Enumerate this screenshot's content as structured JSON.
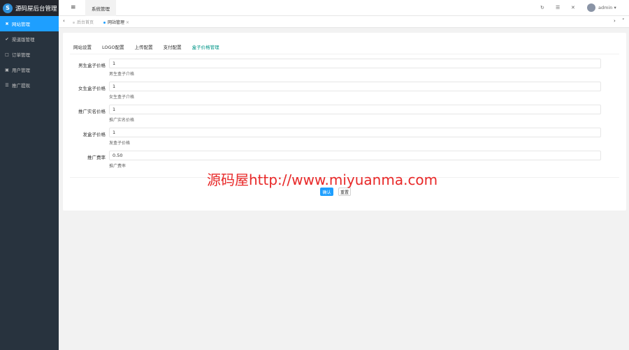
{
  "app": {
    "logo_text": "源码屋后台管理",
    "logo_mark": "S"
  },
  "sidebar": {
    "items": [
      {
        "label": "网站管理",
        "icon": "✖"
      },
      {
        "label": "渠道版管理",
        "icon": "✔"
      },
      {
        "label": "订单管理",
        "icon": "□"
      },
      {
        "label": "用户管理",
        "icon": "▣"
      },
      {
        "label": "推广提现",
        "icon": "☰"
      }
    ]
  },
  "header": {
    "menu_icon": "≡",
    "tab_label": "系统管理",
    "refresh_icon": "↻",
    "note_icon": "☰",
    "fullscreen_icon": "✕",
    "username": "admin",
    "caret": "▾"
  },
  "tabsbar": {
    "left_arrow": "‹",
    "home_label": "后台首页",
    "current_label": "网站管理",
    "close_glyph": "×",
    "right_arrow": "›",
    "more_arrow": "˅"
  },
  "settings": {
    "tabs": [
      "网站设置",
      "LOGO配置",
      "上传配置",
      "支付配置",
      "盒子价格管理"
    ],
    "fields": [
      {
        "label": "男生盒子价格",
        "value": "1",
        "help": "男生盒子介格"
      },
      {
        "label": "女生盒子价格",
        "value": "1",
        "help": "女生盒子介格"
      },
      {
        "label": "推广实名价格",
        "value": "1",
        "help": "推广实名价格"
      },
      {
        "label": "发盒子价格",
        "value": "1",
        "help": "发盒子价格"
      },
      {
        "label": "推广费率",
        "value": "0.50",
        "help": "推广费率"
      }
    ],
    "submit_label": "确认",
    "reset_label": "重置"
  },
  "watermark": "源码屋http://www.miyuanma.com",
  "colors": {
    "accent": "#1e9fff",
    "sidebar": "#28333e",
    "active_tab": "#009688"
  }
}
